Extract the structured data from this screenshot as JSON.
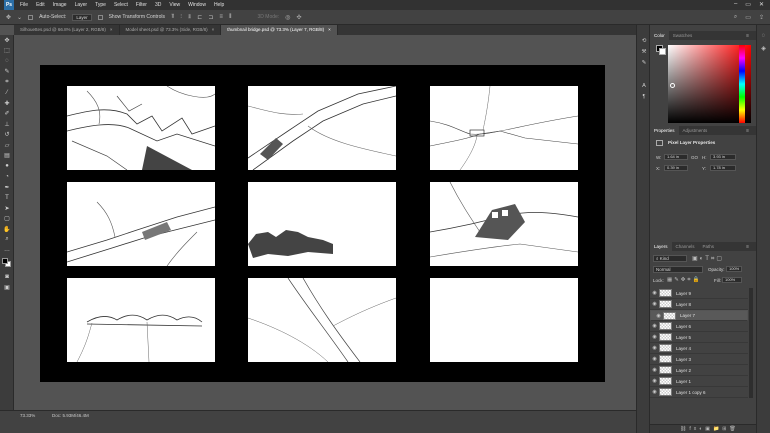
{
  "app": {
    "logo": "Ps"
  },
  "menu": [
    "File",
    "Edit",
    "Image",
    "Layer",
    "Type",
    "Select",
    "Filter",
    "3D",
    "View",
    "Window",
    "Help"
  ],
  "window_controls": [
    "–",
    "▭",
    "✕"
  ],
  "options": {
    "auto_select_label": "Auto-Select:",
    "auto_select_value": "Layer",
    "transform_label": "Show Transform Controls",
    "mode_3d": "3D Mode:"
  },
  "tabs": [
    {
      "label": "Silhouettes.psd @ 66.8% (Layer 2, RGB/8)"
    },
    {
      "label": "Model sheet.psd @ 73.3% (Side, RGB/8)"
    },
    {
      "label": "thumbnail bridge.psd @ 73.3% (Layer 7, RGB/8)"
    }
  ],
  "tab_close": "×",
  "status": {
    "zoom": "73.33%",
    "doc": "Doc: 5.93M/46.4M"
  },
  "color_panel": {
    "tabs": [
      "Color",
      "Swatches"
    ]
  },
  "properties_panel": {
    "tabs": [
      "Properties",
      "Adjustments"
    ],
    "title": "Pixel Layer Properties",
    "w_label": "W:",
    "w_value": "1.64 in",
    "h_label": "H:",
    "h_value": "3.93 in",
    "x_label": "X:",
    "x_value": "0.39 in",
    "y_label": "Y:",
    "y_value": "1.78 in",
    "go_label": "GO"
  },
  "layers_panel": {
    "tabs": [
      "Layers",
      "Channels",
      "Paths"
    ],
    "kind_label": "Kind",
    "blend_mode": "Normal",
    "opacity_label": "Opacity:",
    "opacity_value": "100%",
    "lock_label": "Lock:",
    "fill_label": "Fill:",
    "fill_value": "100%",
    "layers": [
      {
        "name": "Layer 9",
        "selected": false
      },
      {
        "name": "Layer 8",
        "selected": false
      },
      {
        "name": "Layer 7",
        "selected": true
      },
      {
        "name": "Layer 6",
        "selected": false
      },
      {
        "name": "Layer 5",
        "selected": false
      },
      {
        "name": "Layer 4",
        "selected": false
      },
      {
        "name": "Layer 3",
        "selected": false
      },
      {
        "name": "Layer 2",
        "selected": false
      },
      {
        "name": "Layer 1",
        "selected": false
      },
      {
        "name": "Layer 1 copy 6",
        "selected": false
      }
    ]
  },
  "tools": [
    "move-icon",
    "marquee-icon",
    "lasso-icon",
    "quick-select-icon",
    "crop-icon",
    "eyedropper-icon",
    "healing-icon",
    "brush-icon",
    "stamp-icon",
    "history-brush-icon",
    "eraser-icon",
    "gradient-icon",
    "blur-icon",
    "dodge-icon",
    "pen-icon",
    "type-icon",
    "path-select-icon",
    "rectangle-icon",
    "hand-icon",
    "zoom-icon",
    "more-icon"
  ]
}
